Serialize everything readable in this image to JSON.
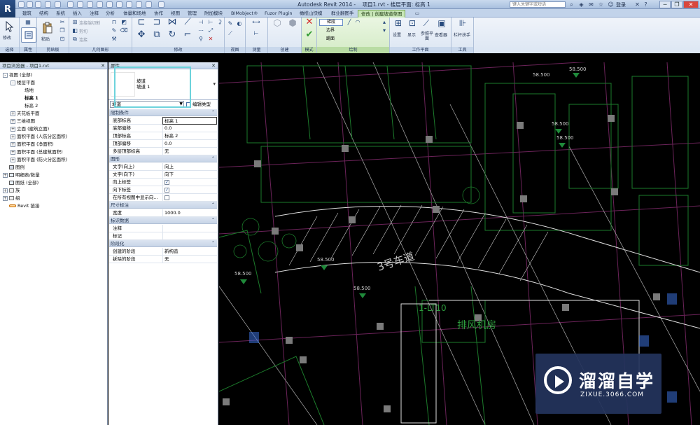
{
  "window": {
    "app_title": "Autodesk Revit 2014 -",
    "doc_title": "项目1.rvt - 楼层平面: 标高 1",
    "search_placeholder": "键入关键字或短语",
    "login": "登录",
    "minimize": "─",
    "restore": "❐",
    "close": "✕"
  },
  "tabs": [
    {
      "label": "建筑"
    },
    {
      "label": "结构"
    },
    {
      "label": "系统"
    },
    {
      "label": "插入"
    },
    {
      "label": "注释"
    },
    {
      "label": "分析"
    },
    {
      "label": "体量和场地"
    },
    {
      "label": "协作"
    },
    {
      "label": "视图"
    },
    {
      "label": "管理"
    },
    {
      "label": "附加模块"
    },
    {
      "label": "BIMobject®"
    },
    {
      "label": "Fuzor Plugin"
    },
    {
      "label": "橄榄山快模"
    },
    {
      "label": "群业翻图手"
    },
    {
      "label": "修改 | 创建坡道草图"
    }
  ],
  "ribbon": {
    "panels": [
      {
        "label": "选择",
        "button": "修改"
      },
      {
        "label": "属性",
        "button": ""
      },
      {
        "label": "剪贴板",
        "button": "粘贴"
      },
      {
        "label": "几何图形",
        "items": [
          "连接端切割",
          "剪切",
          "连接"
        ]
      },
      {
        "label": "修改"
      },
      {
        "label": "视图"
      },
      {
        "label": "测量"
      },
      {
        "label": "创建"
      },
      {
        "label": "模式"
      },
      {
        "label": "绘制",
        "items": [
          "梯段",
          "边界",
          "踢面"
        ]
      },
      {
        "label": "工作平面",
        "buttons": [
          "设置",
          "显示",
          "参照平面",
          "查看器"
        ]
      },
      {
        "label": "工具",
        "buttons": [
          "栏杆扶手"
        ]
      }
    ]
  },
  "project_browser": {
    "title": "项目浏览器 - 项目1.rvt",
    "items": [
      {
        "label": "视图 (全部)",
        "level": 0,
        "exp": "-"
      },
      {
        "label": "楼层平面",
        "level": 1,
        "exp": "-"
      },
      {
        "label": "场地",
        "level": 2,
        "exp": ""
      },
      {
        "label": "标高 1",
        "level": 2,
        "exp": "",
        "bold": true
      },
      {
        "label": "标高 2",
        "level": 2,
        "exp": ""
      },
      {
        "label": "天花板平面",
        "level": 1,
        "exp": "+"
      },
      {
        "label": "三维视图",
        "level": 1,
        "exp": "+"
      },
      {
        "label": "立面 (建筑立面)",
        "level": 1,
        "exp": "+"
      },
      {
        "label": "面积平面 (人防分区面积)",
        "level": 1,
        "exp": "+"
      },
      {
        "label": "面积平面 (净面积)",
        "level": 1,
        "exp": "+"
      },
      {
        "label": "面积平面 (总建筑面积)",
        "level": 1,
        "exp": "+"
      },
      {
        "label": "面积平面 (防火分区面积)",
        "level": 1,
        "exp": "+"
      },
      {
        "label": "图例",
        "level": 0,
        "exp": "",
        "icon": "legend"
      },
      {
        "label": "明细表/数量",
        "level": 0,
        "exp": "+",
        "icon": "sheet"
      },
      {
        "label": "图纸 (全部)",
        "level": 0,
        "exp": "",
        "icon": "sheet"
      },
      {
        "label": "族",
        "level": 0,
        "exp": "+",
        "icon": "family"
      },
      {
        "label": "组",
        "level": 0,
        "exp": "+",
        "icon": "family"
      },
      {
        "label": "Revit 链接",
        "level": 0,
        "exp": "",
        "icon": "link"
      }
    ]
  },
  "properties": {
    "title": "属性",
    "type_family": "坡道",
    "type_name": "坡道 1",
    "filter_value": "坡道",
    "edit_type": "编辑类型",
    "groups": [
      {
        "name": "限制条件",
        "rows": [
          {
            "name": "底部标高",
            "value": "标高 1",
            "edit": true
          },
          {
            "name": "底部偏移",
            "value": "0.0"
          },
          {
            "name": "顶部标高",
            "value": "标高 2"
          },
          {
            "name": "顶部偏移",
            "value": "0.0"
          },
          {
            "name": "多层顶部标高",
            "value": "无"
          }
        ]
      },
      {
        "name": "图形",
        "rows": [
          {
            "name": "文字(向上)",
            "value": "向上"
          },
          {
            "name": "文字(向下)",
            "value": "向下"
          },
          {
            "name": "向上标签",
            "check": true
          },
          {
            "name": "向下标签",
            "check": true
          },
          {
            "name": "在所有视图中显示向...",
            "check": false
          }
        ]
      },
      {
        "name": "尺寸标注",
        "rows": [
          {
            "name": "宽度",
            "value": "1000.0"
          }
        ]
      },
      {
        "name": "标识数据",
        "rows": [
          {
            "name": "注释",
            "value": ""
          },
          {
            "name": "标记",
            "value": ""
          }
        ]
      },
      {
        "name": "阶段化",
        "rows": [
          {
            "name": "创建的阶段",
            "value": "新构造"
          },
          {
            "name": "拆除的阶段",
            "value": "无"
          }
        ]
      }
    ]
  },
  "canvas": {
    "labels": [
      {
        "text": "3号车道"
      },
      {
        "text": "排风机房"
      },
      {
        "text": "1-LT10"
      },
      {
        "text": "58.500"
      },
      {
        "text": "58.500"
      },
      {
        "text": "58.500"
      },
      {
        "text": "58.500"
      },
      {
        "text": "58.500"
      },
      {
        "text": "58.500"
      },
      {
        "text": "58.500"
      }
    ]
  },
  "watermark": {
    "title": "溜溜自学",
    "url": "ZIXUE.3066.COM"
  },
  "colors": {
    "ribbon_bg": "#dce6f3",
    "context_tab": "#c8e6b8",
    "canvas_bg": "#000000",
    "cad_magenta": "#8a2a6e",
    "cad_green": "#1f8a2e",
    "cad_white": "#d8d8d8",
    "highlight": "#6dd3dc"
  }
}
